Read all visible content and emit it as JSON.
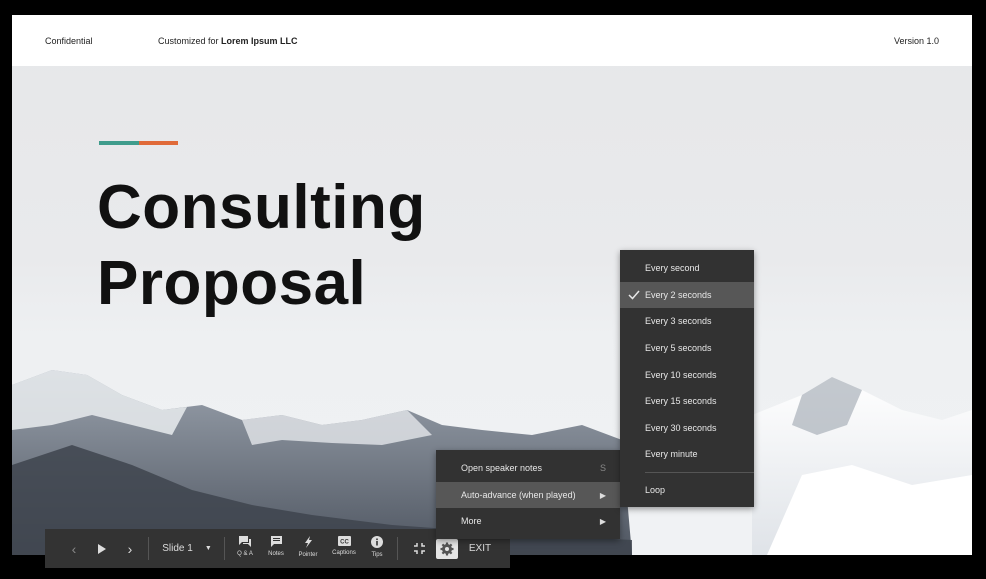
{
  "header": {
    "confidential": "Confidential",
    "customized_prefix": "Customized for",
    "customer": "Lorem Ipsum LLC",
    "version": "Version 1.0"
  },
  "slide": {
    "title_line1": "Consulting",
    "title_line2": "Proposal",
    "accent_colors": [
      "#3f9c8c",
      "#e06a39"
    ]
  },
  "toolbar": {
    "slide_label": "Slide 1",
    "tools": [
      {
        "label": "Q & A",
        "icon": "qa-icon"
      },
      {
        "label": "Notes",
        "icon": "notes-icon"
      },
      {
        "label": "Pointer",
        "icon": "pointer-icon"
      },
      {
        "label": "Captions",
        "icon": "captions-icon"
      },
      {
        "label": "Tips",
        "icon": "info-icon"
      }
    ],
    "exit_label": "EXIT"
  },
  "settings_menu": {
    "items": [
      {
        "label": "Open speaker notes",
        "shortcut": "S"
      },
      {
        "label": "Auto-advance (when played)"
      },
      {
        "label": "More"
      }
    ]
  },
  "auto_advance_menu": {
    "items": [
      "Every second",
      "Every 2 seconds",
      "Every 3 seconds",
      "Every 5 seconds",
      "Every 10 seconds",
      "Every 15 seconds",
      "Every 30 seconds",
      "Every minute"
    ],
    "selected": "Every 2 seconds",
    "loop_label": "Loop"
  }
}
